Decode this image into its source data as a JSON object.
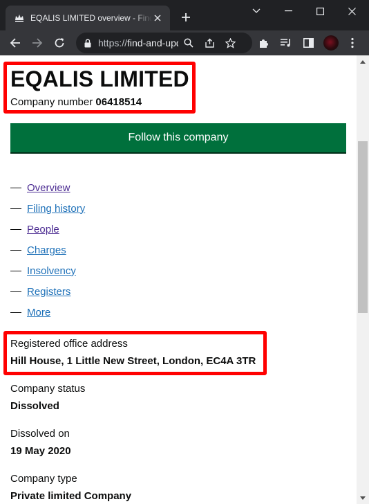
{
  "browser": {
    "tab_title": "EQALIS LIMITED overview - Find and update company information - GOV.UK",
    "url_prefix": "https://",
    "url_host": "find-and-update.company-information.service.gov.uk"
  },
  "company": {
    "name": "EQALIS LIMITED",
    "number_label": "Company number",
    "number": "06418514",
    "follow_label": "Follow this company"
  },
  "nav": [
    {
      "label": "Overview"
    },
    {
      "label": "Filing history"
    },
    {
      "label": "People"
    },
    {
      "label": "Charges"
    },
    {
      "label": "Insolvency"
    },
    {
      "label": "Registers"
    },
    {
      "label": "More"
    }
  ],
  "details": {
    "registered_office_label": "Registered office address",
    "registered_office_value": "Hill House, 1 Little New Street, London, EC4A 3TR",
    "status_label": "Company status",
    "status_value": "Dissolved",
    "dissolved_label": "Dissolved on",
    "dissolved_value": "19 May 2020",
    "type_label": "Company type",
    "type_value": "Private limited Company"
  },
  "colors": {
    "highlight": "#ff0000",
    "follow_button": "#00703c",
    "link_visited": "#4c2c92",
    "link": "#1d70b8"
  }
}
